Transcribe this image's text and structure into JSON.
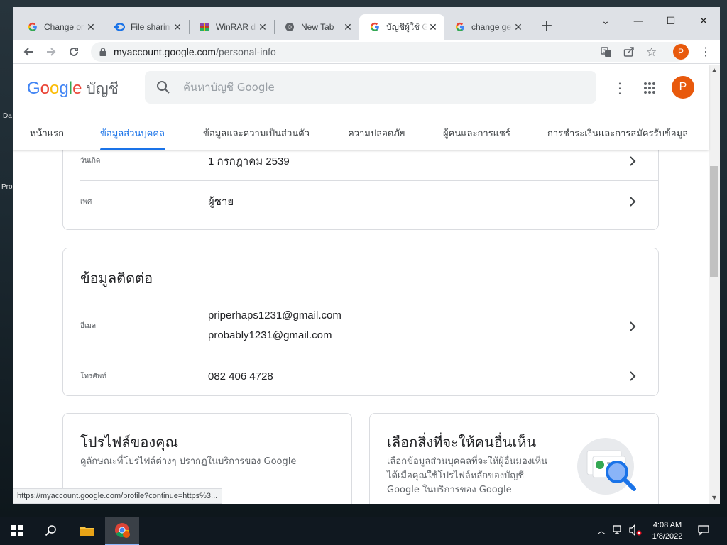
{
  "desktop": {
    "labels": [
      "Da",
      "Pro"
    ]
  },
  "browser": {
    "tabs": [
      {
        "title": "Change or",
        "icon": "google-icon",
        "active": false
      },
      {
        "title": "File sharin",
        "icon": "file-share-icon",
        "active": false
      },
      {
        "title": "WinRAR d",
        "icon": "winrar-icon",
        "active": false
      },
      {
        "title": "New Tab",
        "icon": "chrome-icon",
        "active": false
      },
      {
        "title": "บัญชีผู้ใช้ G",
        "icon": "google-icon",
        "active": true
      },
      {
        "title": "change ge",
        "icon": "google-icon",
        "active": false
      }
    ],
    "new_tab": "+",
    "window_controls": {
      "minimize": "—",
      "maximize": "☐",
      "close": "✕",
      "tab_search": "⌄"
    },
    "url_host": "myaccount.google.com",
    "url_path": "/personal-info",
    "profile_initial": "P"
  },
  "header": {
    "logo_letters": [
      "G",
      "o",
      "o",
      "g",
      "l",
      "e"
    ],
    "account_text": "บัญชี",
    "search_placeholder": "ค้นหาบัญชี Google",
    "avatar_initial": "P"
  },
  "nav": {
    "tabs": [
      {
        "label": "หน้าแรก",
        "active": false
      },
      {
        "label": "ข้อมูลส่วนบุคคล",
        "active": true
      },
      {
        "label": "ข้อมูลและความเป็นส่วนตัว",
        "active": false
      },
      {
        "label": "ความปลอดภัย",
        "active": false
      },
      {
        "label": "ผู้คนและการแชร์",
        "active": false
      },
      {
        "label": "การชำระเงินและการสมัครรับข้อมูล",
        "active": false
      }
    ]
  },
  "basic_info": {
    "rows": [
      {
        "label": "วันเกิด",
        "value": "1 กรกฎาคม 2539"
      },
      {
        "label": "เพศ",
        "value": "ผู้ชาย"
      }
    ]
  },
  "contact": {
    "title": "ข้อมูลติดต่อ",
    "email_label": "อีเมล",
    "emails": [
      "priperhaps1231@gmail.com",
      "probably1231@gmail.com"
    ],
    "phone_label": "โทรศัพท์",
    "phone": "082 406 4728"
  },
  "profile_card": {
    "title": "โปรไฟล์ของคุณ",
    "subtitle": "ดูลักษณะที่โปรไฟล์ต่างๆ ปรากฏในบริการของ Google"
  },
  "visibility_card": {
    "title": "เลือกสิ่งที่จะให้คนอื่นเห็น",
    "subtitle_lines": [
      "เลือกข้อมูลส่วนบุคคลที่จะให้ผู้อื่นมองเห็น",
      "ได้เมื่อคุณใช้โปรไฟล์หลักของบัญชี",
      "Google ในบริการของ Google"
    ]
  },
  "status_bar": {
    "url": "https://myaccount.google.com/profile?continue=https%3..."
  },
  "taskbar": {
    "time": "4:08 AM",
    "date": "1/8/2022"
  },
  "colors": {
    "accent": "#1a73e8",
    "avatar": "#e8590c"
  }
}
